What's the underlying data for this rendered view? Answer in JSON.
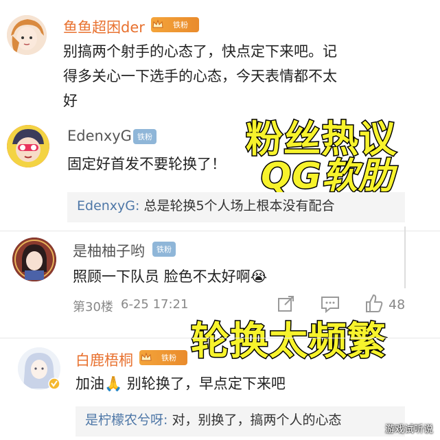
{
  "comments": [
    {
      "username": "鱼鱼超困der",
      "badge": "铁粉",
      "lines": [
        "别搞两个射手的心态了，快点定下来吧。记",
        "得多关心一下选手的心态，今天表情都不太",
        "好"
      ]
    },
    {
      "username": "EdenxyG",
      "badge": "铁粉",
      "lines": [
        "固定好首发不要轮换了！"
      ],
      "reply": {
        "who": "EdenxyG:",
        "text": " 总是轮换5个人场上根本没有配合"
      }
    },
    {
      "username": "是柚柚子哟",
      "badge": "铁粉",
      "lines": [
        "照顾一下队员 脸色不太好啊😭"
      ],
      "meta": {
        "floor": "第30楼",
        "time": "6-25 17:21",
        "likes": "48"
      }
    },
    {
      "username": "白鹿梧桐",
      "badge": "铁粉",
      "lines": [
        "加油🙏 别轮换了，早点定下来吧"
      ],
      "reply": {
        "who": "是柠檬农兮呀:",
        "text": " 对，别换了，搞两个人的心态"
      }
    }
  ],
  "overlays": {
    "line1": "粉丝热议",
    "line2": "QG软肋",
    "line3": "轮换太频繁"
  },
  "watermark": "游戏试听说",
  "colors": {
    "overlay_fill": "#f7f32c",
    "username_orange": "#e8712f",
    "reply_name": "#4e77a7",
    "badge_blue": "#8fb6d8"
  }
}
